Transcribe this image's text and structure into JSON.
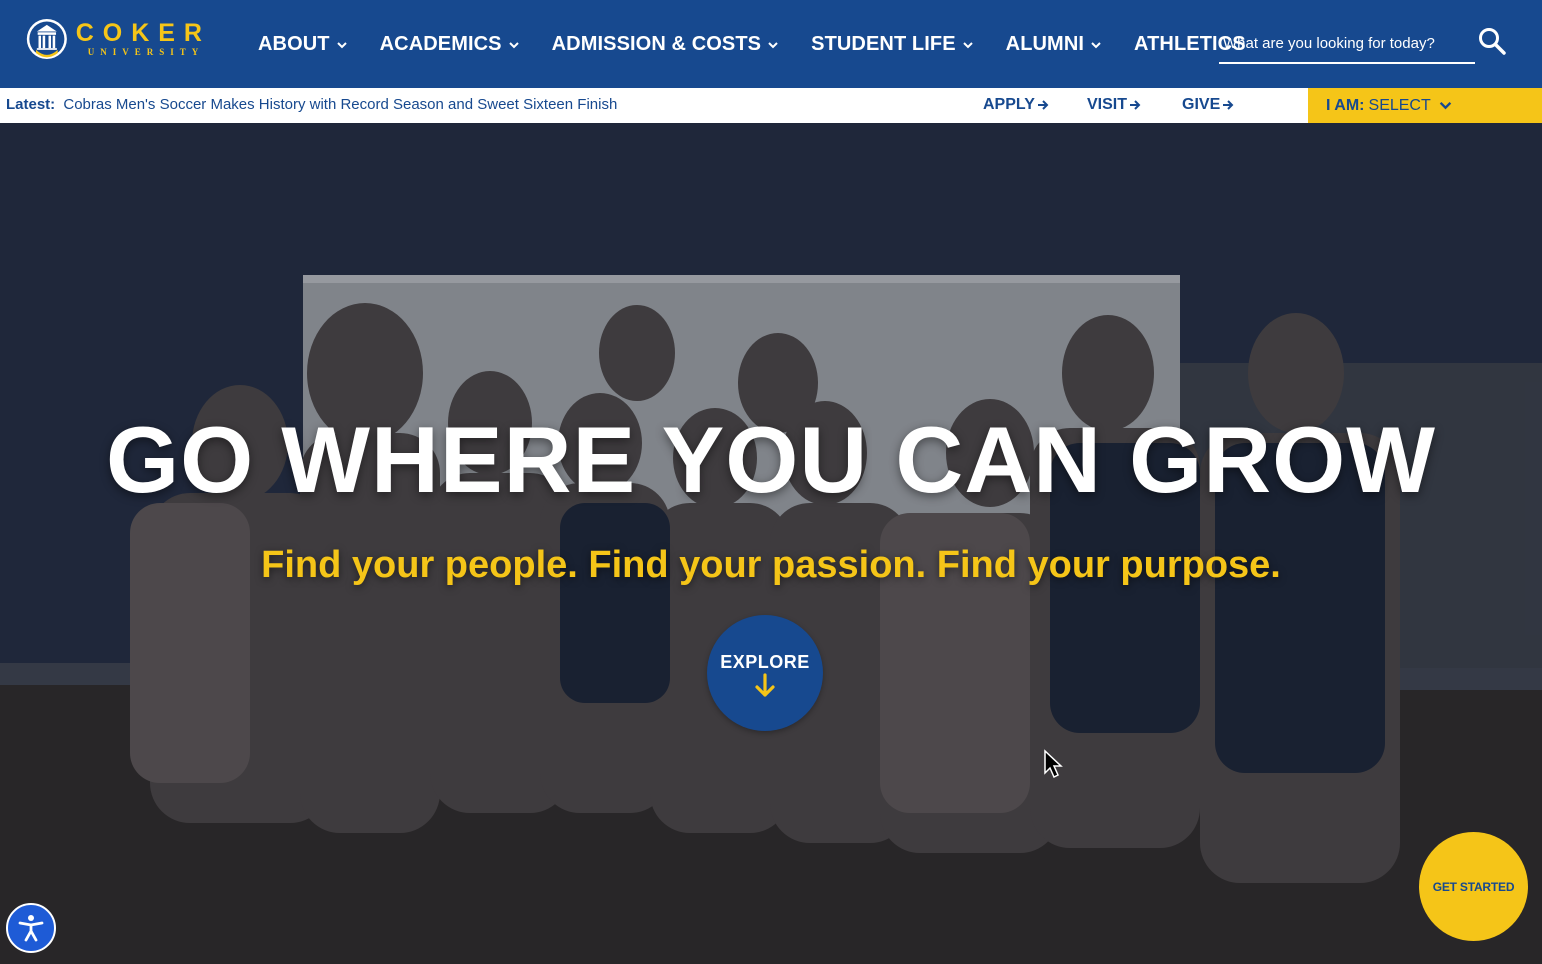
{
  "brand": {
    "name": "COKER",
    "subname": "UNIVERSITY",
    "primary_color": "#17498f",
    "accent_color": "#f5c518"
  },
  "nav": {
    "items": [
      {
        "label": "ABOUT",
        "dropdown": true
      },
      {
        "label": "ACADEMICS",
        "dropdown": true
      },
      {
        "label": "ADMISSION & COSTS",
        "dropdown": true
      },
      {
        "label": "STUDENT LIFE",
        "dropdown": true
      },
      {
        "label": "ALUMNI",
        "dropdown": true
      },
      {
        "label": "ATHLETICS",
        "dropdown": false
      }
    ],
    "search_placeholder": "What are you looking for today?",
    "search_icon": "search-icon"
  },
  "utility": {
    "latest_label": "Latest:",
    "latest_headline": "Cobras Men's Soccer Makes History with Record Season and Sweet Sixteen Finish",
    "quick_links": [
      "APPLY",
      "VISIT",
      "GIVE"
    ],
    "iam_label": "I AM:",
    "iam_value": "SELECT"
  },
  "hero": {
    "title": "GO WHERE YOU CAN GROW",
    "subtitle": "Find your people. Find your passion. Find your purpose.",
    "explore_label": "EXPLORE"
  },
  "floating": {
    "get_started": "GET STARTED",
    "accessibility_icon": "accessibility-icon"
  }
}
